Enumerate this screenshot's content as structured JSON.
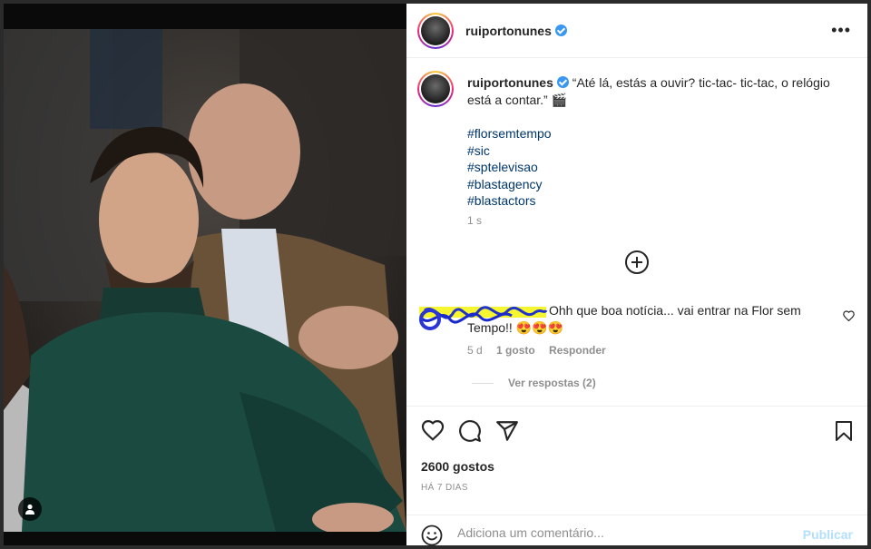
{
  "post": {
    "username": "ruiportonunes",
    "more_icon": "more-horizontal-icon"
  },
  "caption": {
    "username": "ruiportonunes",
    "text": "“Até lá, estás a ouvir? tic-tac- tic-tac, o relógio está a contar.” 🎬",
    "hashtags": [
      "#florsemtempo",
      "#sic",
      "#sptelevisao",
      "#blastagency",
      "#blastactors"
    ],
    "time": "1 s"
  },
  "comment": {
    "text_line1": "Ohh que boa notícia... vai entrar na Flor sem",
    "text_line2": "Tempo!! 😍😍😍",
    "age": "5 d",
    "likes": "1 gosto",
    "reply": "Responder",
    "view_replies": "Ver respostas (2)"
  },
  "actions": {
    "likes_count": "2600 gostos",
    "post_age": "HÁ 7 DIAS"
  },
  "add_comment": {
    "placeholder": "Adiciona um comentário...",
    "publish": "Publicar"
  },
  "colors": {
    "hashtag": "#00376b",
    "verified": "#3897f0",
    "publish_disabled": "#b2dffc"
  }
}
